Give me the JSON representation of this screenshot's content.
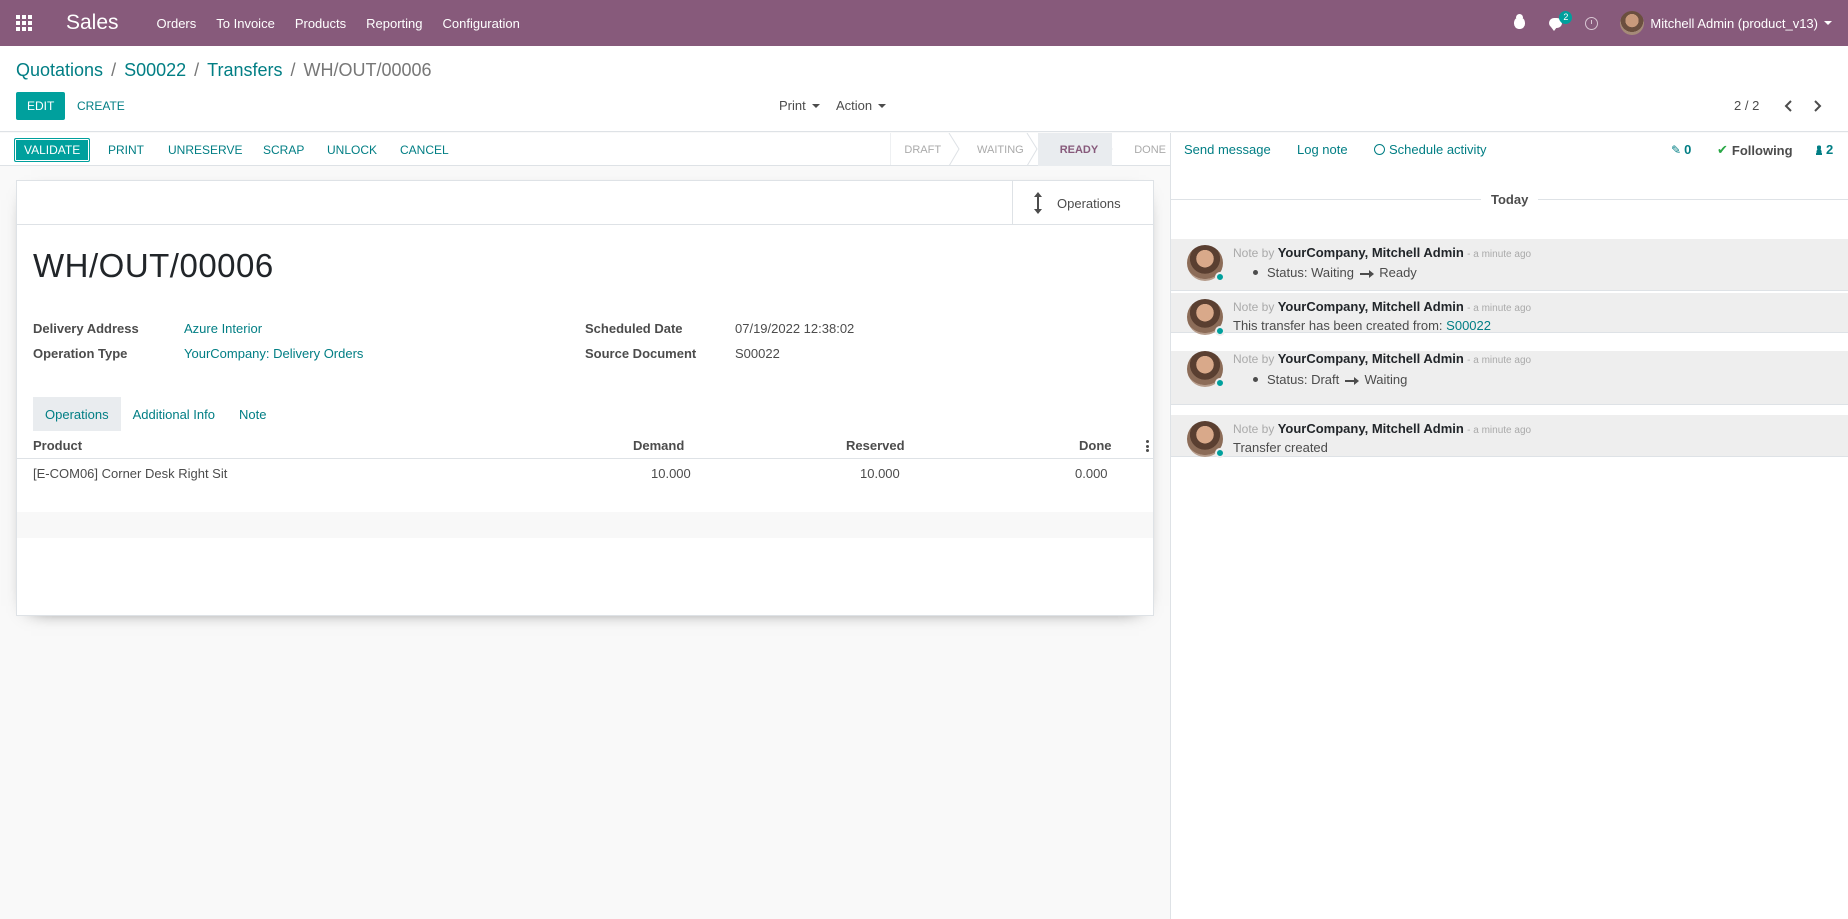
{
  "navbar": {
    "app_name": "Sales",
    "menu": [
      "Orders",
      "To Invoice",
      "Products",
      "Reporting",
      "Configuration"
    ],
    "messages_badge": "2",
    "user_name": "Mitchell Admin (product_v13)"
  },
  "breadcrumb": [
    "Quotations",
    "S00022",
    "Transfers",
    "WH/OUT/00006"
  ],
  "control": {
    "edit_label": "EDIT",
    "create_label": "CREATE",
    "print_label": "Print",
    "action_label": "Action",
    "pager": "2 / 2"
  },
  "statusbar": {
    "buttons": [
      "VALIDATE",
      "PRINT",
      "UNRESERVE",
      "SCRAP",
      "UNLOCK",
      "CANCEL"
    ],
    "stages": [
      "DRAFT",
      "WAITING",
      "READY",
      "DONE"
    ],
    "active_stage": "READY"
  },
  "form": {
    "operations_button": "Operations",
    "title": "WH/OUT/00006",
    "fields": {
      "delivery_address_label": "Delivery Address",
      "delivery_address": "Azure Interior",
      "operation_type_label": "Operation Type",
      "operation_type": "YourCompany: Delivery Orders",
      "scheduled_date_label": "Scheduled Date",
      "scheduled_date": "07/19/2022 12:38:02",
      "source_document_label": "Source Document",
      "source_document": "S00022"
    },
    "tabs": [
      "Operations",
      "Additional Info",
      "Note"
    ],
    "table": {
      "headers": [
        "Product",
        "Demand",
        "Reserved",
        "Done"
      ],
      "rows": [
        [
          "[E-COM06] Corner Desk Right Sit",
          "10.000",
          "10.000",
          "0.000"
        ]
      ]
    }
  },
  "chatter": {
    "send_message": "Send message",
    "log_note": "Log note",
    "schedule_activity": "Schedule activity",
    "attachments_count": "0",
    "following": "Following",
    "followers_count": "2",
    "today": "Today",
    "messages": [
      {
        "type": "Note by",
        "author": "YourCompany, Mitchell Admin",
        "ago": "- a minute ago",
        "from": "Waiting",
        "to": "Ready"
      },
      {
        "type": "Note by",
        "author": "YourCompany, Mitchell Admin",
        "ago": "- a minute ago",
        "text": "This transfer has been created from:",
        "link": "S00022"
      },
      {
        "type": "Note by",
        "author": "YourCompany, Mitchell Admin",
        "ago": "- a minute ago",
        "from": "Draft",
        "to": "Waiting"
      },
      {
        "type": "Note by",
        "author": "YourCompany, Mitchell Admin",
        "ago": "- a minute ago",
        "text": "Transfer created"
      }
    ],
    "status_label": "Status:"
  },
  "colors": {
    "brand": "#875a7b",
    "accent": "#00a09d",
    "link": "#017e84"
  }
}
